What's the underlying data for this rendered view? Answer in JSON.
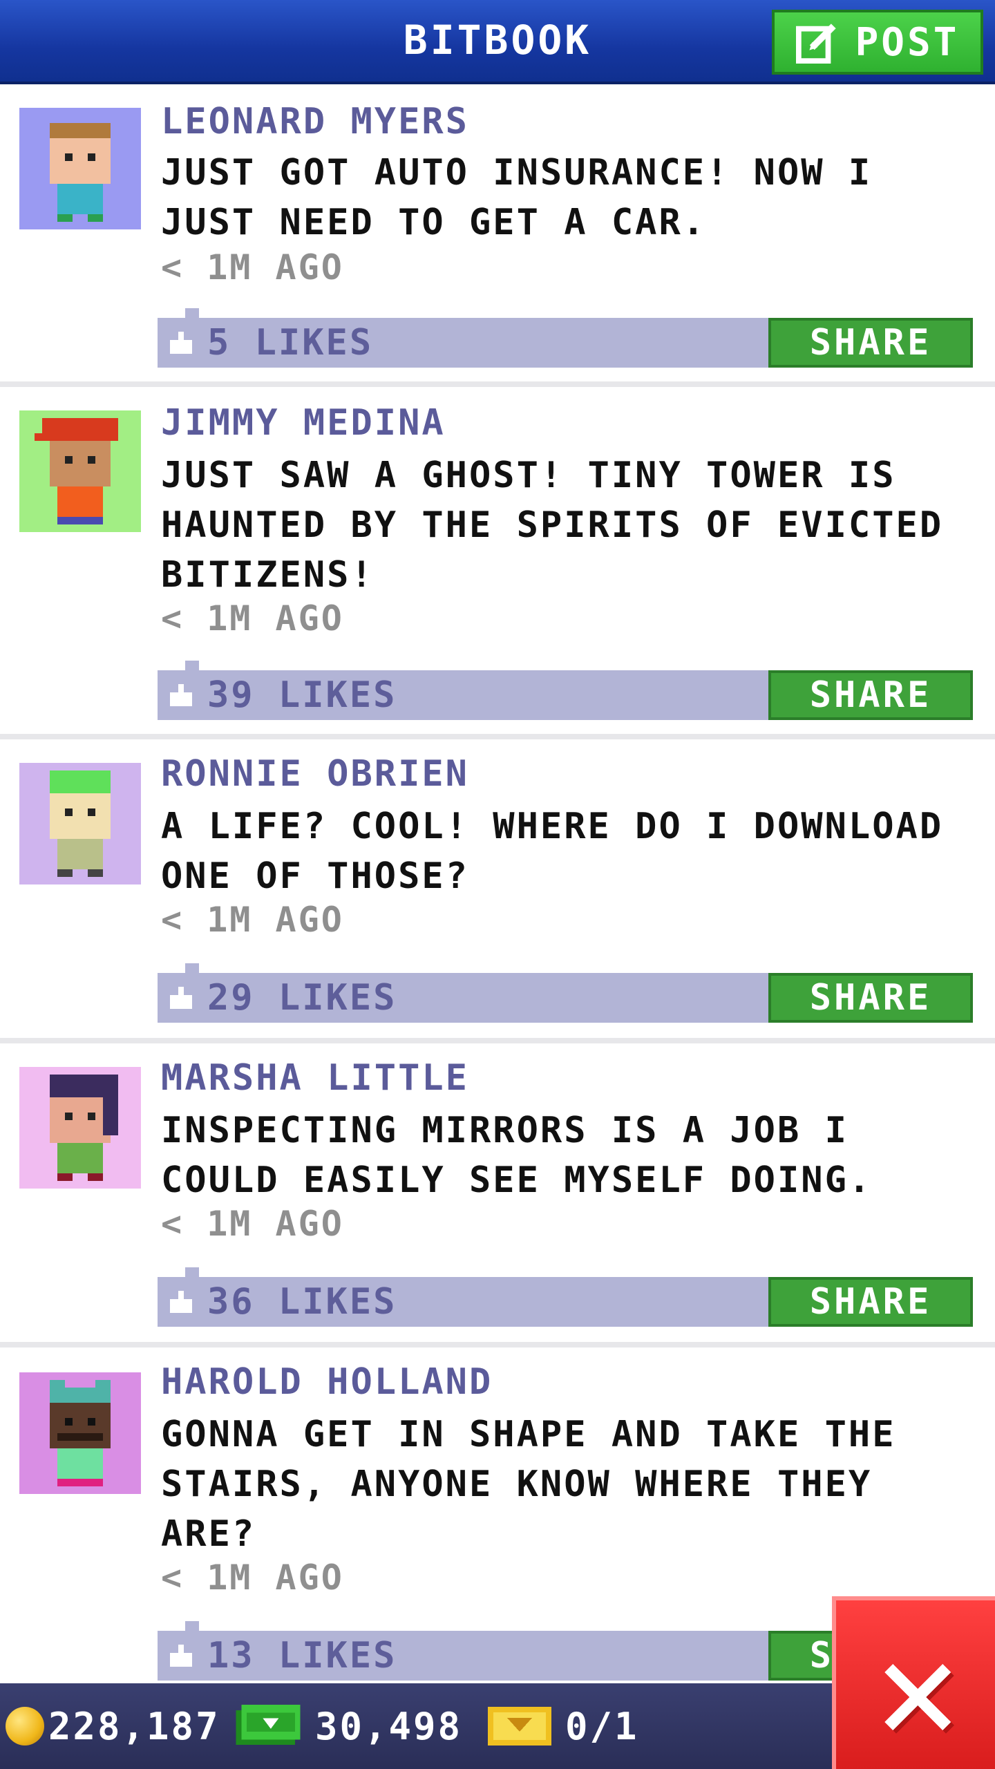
{
  "header": {
    "title": "BITBOOK",
    "post_label": "POST"
  },
  "posts": [
    {
      "author": "LEONARD MYERS",
      "message": "JUST GOT AUTO INSURANCE! NOW I JUST NEED TO GET A CAR.",
      "time": "< 1M AGO",
      "likes": "5 LIKES",
      "share": "SHARE",
      "avatar_bg": "#9a9af2",
      "shirt": "#3ab3c8",
      "hair": "#b07a3c"
    },
    {
      "author": "JIMMY MEDINA",
      "message": "JUST SAW A GHOST! TINY TOWER IS HAUNTED BY THE SPIRITS OF EVICTED BITIZENS!",
      "time": "< 1M AGO",
      "likes": "39 LIKES",
      "share": "SHARE",
      "avatar_bg": "#a2ee84",
      "shirt": "#f25e1e",
      "hair": "#d83a1e"
    },
    {
      "author": "RONNIE OBRIEN",
      "message": "A LIFE? COOL! WHERE DO I DOWNLOAD ONE OF THOSE?",
      "time": "< 1M AGO",
      "likes": "29 LIKES",
      "share": "SHARE",
      "avatar_bg": "#cfb4ee",
      "shirt": "#b9c08a",
      "hair": "#5fe05a"
    },
    {
      "author": "MARSHA LITTLE",
      "message": "INSPECTING MIRRORS IS A JOB I COULD EASILY SEE MYSELF DOING.",
      "time": "< 1M AGO",
      "likes": "36 LIKES",
      "share": "SHARE",
      "avatar_bg": "#f1bcf1",
      "shirt": "#6ab04a",
      "hair": "#3b2c5e"
    },
    {
      "author": "HAROLD HOLLAND",
      "message": "GONNA GET IN SHAPE AND TAKE THE STAIRS, ANYONE KNOW WHERE THEY ARE?",
      "time": "< 1M AGO",
      "likes": "13 LIKES",
      "share": "SHARE",
      "avatar_bg": "#d98ee4",
      "shirt": "#6ee0a0",
      "hair": "#4fb3a8"
    }
  ],
  "bottom_bar": {
    "coins": "228,187",
    "bux": "30,498",
    "tickets": "0/1"
  },
  "colors": {
    "header": "#1536a0",
    "post_button": "#3ec23c",
    "like_bar": "#b2b4d6",
    "share_button": "#3ea23a",
    "close_button": "#e02525"
  }
}
